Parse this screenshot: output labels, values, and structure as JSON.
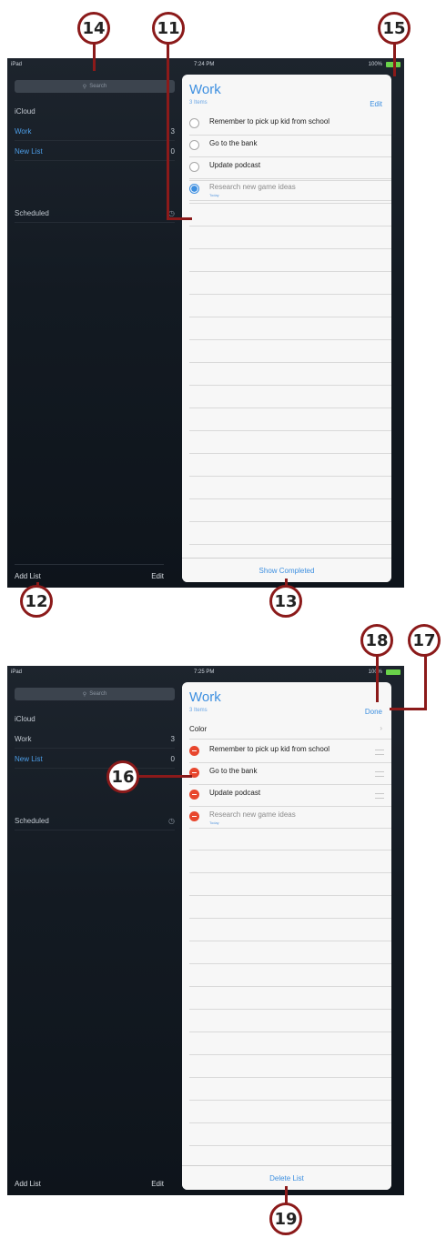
{
  "callouts": {
    "c11": "11",
    "c12": "12",
    "c13": "13",
    "c14": "14",
    "c15": "15",
    "c16": "16",
    "c17": "17",
    "c18": "18",
    "c19": "19"
  },
  "screen1": {
    "status": {
      "left": "iPad",
      "time": "7:24 PM",
      "battery": "100%"
    },
    "sidebar": {
      "search_placeholder": "Search",
      "section": "iCloud",
      "lists": [
        {
          "name": "Work",
          "count": "3"
        },
        {
          "name": "New List",
          "count": "0"
        }
      ],
      "scheduled": "Scheduled",
      "add_list": "Add List",
      "edit": "Edit"
    },
    "card": {
      "title": "Work",
      "subtitle": "3 Items",
      "action": "Edit",
      "items": [
        {
          "text": "Remember to pick up kid from school"
        },
        {
          "text": "Go to the bank"
        },
        {
          "text": "Update podcast"
        },
        {
          "text": "Research new game ideas",
          "note": "Today"
        }
      ],
      "footer": "Show Completed"
    }
  },
  "screen2": {
    "status": {
      "left": "iPad",
      "time": "7:25 PM",
      "battery": "100%"
    },
    "sidebar": {
      "search_placeholder": "Search",
      "section": "iCloud",
      "lists": [
        {
          "name": "Work",
          "count": "3"
        },
        {
          "name": "New List",
          "count": "0"
        }
      ],
      "scheduled": "Scheduled",
      "add_list": "Add List",
      "edit": "Edit"
    },
    "card": {
      "title": "Work",
      "subtitle": "3 Items",
      "action": "Done",
      "color_label": "Color",
      "items": [
        {
          "text": "Remember to pick up kid from school"
        },
        {
          "text": "Go to the bank"
        },
        {
          "text": "Update podcast"
        },
        {
          "text": "Research new game ideas",
          "note": "Today"
        }
      ],
      "footer": "Delete List"
    }
  }
}
